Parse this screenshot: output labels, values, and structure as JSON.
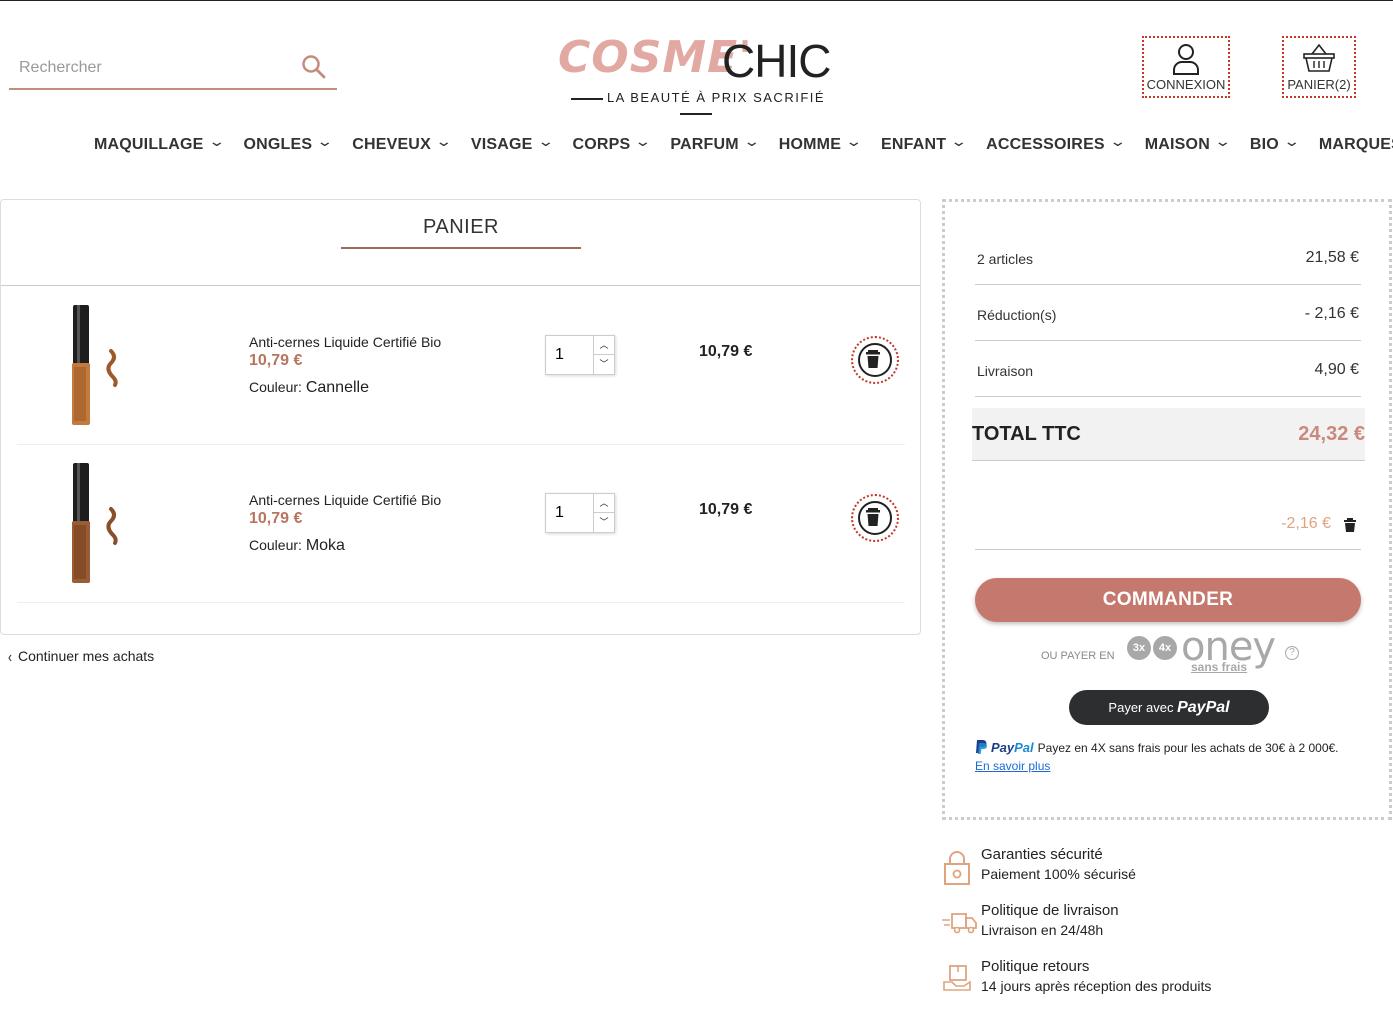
{
  "header": {
    "search_placeholder": "Rechercher",
    "logo_part1": "COSME'",
    "logo_part2": "CHIC",
    "logo_tagline": "LA BEAUTÉ À PRIX SACRIFIÉ",
    "login_label": "CONNEXION",
    "cart_label": "PANIER(2)"
  },
  "nav": [
    {
      "label": "MAQUILLAGE",
      "has_menu": true
    },
    {
      "label": "ONGLES",
      "has_menu": true
    },
    {
      "label": "CHEVEUX",
      "has_menu": true
    },
    {
      "label": "VISAGE",
      "has_menu": true
    },
    {
      "label": "CORPS",
      "has_menu": true
    },
    {
      "label": "PARFUM",
      "has_menu": true
    },
    {
      "label": "HOMME",
      "has_menu": true
    },
    {
      "label": "ENFANT",
      "has_menu": true
    },
    {
      "label": "ACCESSOIRES",
      "has_menu": true
    },
    {
      "label": "MAISON",
      "has_menu": true
    },
    {
      "label": "BIO",
      "has_menu": true
    },
    {
      "label": "MARQUES",
      "has_menu": false
    }
  ],
  "cart": {
    "title": "PANIER",
    "items": [
      {
        "name": "Anti-cernes Liquide Certifié Bio",
        "price": "10,79 €",
        "color_label": "Couleur:",
        "color_value": "Cannelle",
        "quantity": "1",
        "line_total": "10,79 €"
      },
      {
        "name": "Anti-cernes Liquide Certifié Bio",
        "price": "10,79 €",
        "color_label": "Couleur:",
        "color_value": "Moka",
        "quantity": "1",
        "line_total": "10,79 €"
      }
    ],
    "continue_label": "Continuer mes achats"
  },
  "summary": {
    "articles_label": "2 articles",
    "articles_value": "21,58 €",
    "discount_label": "Réduction(s)",
    "discount_value": "- 2,16 €",
    "shipping_label": "Livraison",
    "shipping_value": "4,90 €",
    "total_label": "TOTAL TTC",
    "total_value": "24,32 €",
    "voucher_value": "-2,16 €",
    "order_button": "COMMANDER",
    "oney_label": "OU PAYER EN",
    "oney_badge_3x": "3x",
    "oney_badge_4x": "4x",
    "oney_logo": "oney",
    "oney_sub": "sans frais",
    "oney_help": "?",
    "paypal_button_prefix": "Payer avec",
    "paypal_brand": "PayPal",
    "paypal_4x_brand_a": "Pay",
    "paypal_4x_brand_b": "Pal",
    "paypal_4x_text": "Payez en 4X sans frais pour les achats de 30€ à 2 000€.",
    "paypal_4x_link": "En savoir plus"
  },
  "reassurance": [
    {
      "icon": "lock-icon",
      "title": "Garanties sécurité",
      "subtitle": "Paiement 100% sécurisé"
    },
    {
      "icon": "delivery-truck-icon",
      "title": "Politique de livraison",
      "subtitle": "Livraison en 24/48h"
    },
    {
      "icon": "return-box-icon",
      "title": "Politique retours",
      "subtitle": "14 jours après réception des produits"
    }
  ],
  "colors": {
    "brand_rose": "#c4786e",
    "price_color": "#b9745f",
    "logo_pink": "#e2a9a3",
    "voucher_color": "#e0a37f"
  }
}
